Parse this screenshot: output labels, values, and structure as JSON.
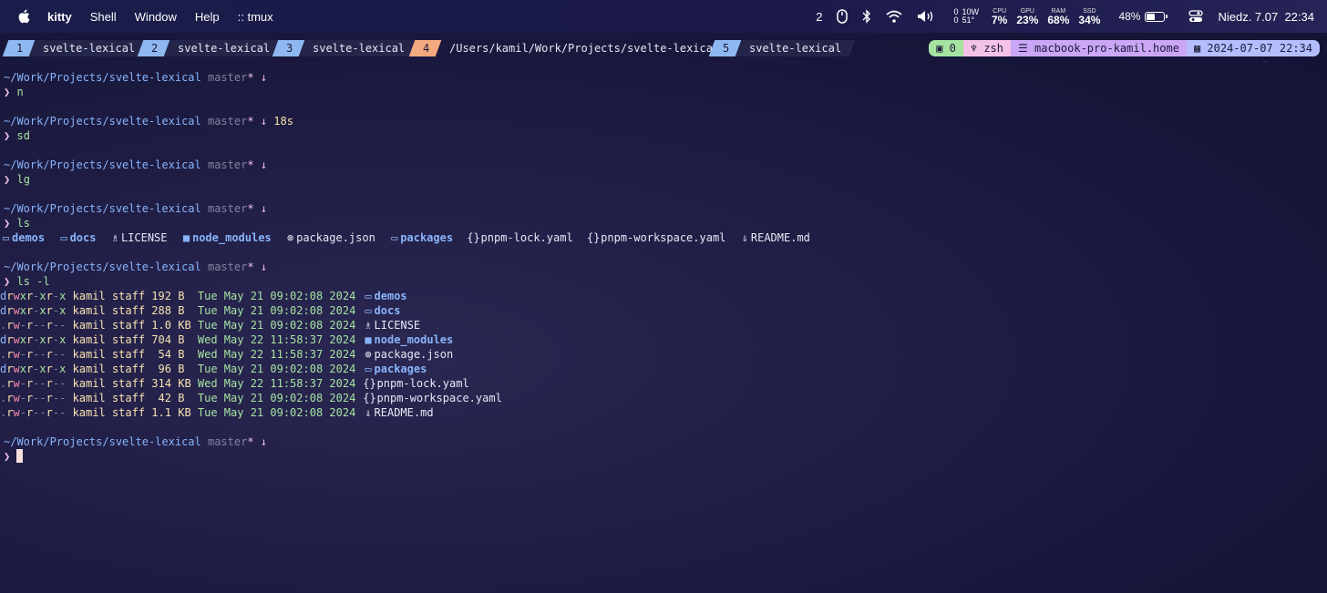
{
  "menubar": {
    "app_name": "kitty",
    "menus": [
      "Shell",
      "Window",
      "Help",
      ":: tmux"
    ],
    "spaces": "2",
    "power": {
      "watts": "10W",
      "temp": "51°",
      "a": "0",
      "b": "0"
    },
    "stats": [
      {
        "label": "CPU",
        "value": "7%"
      },
      {
        "label": "GPU",
        "value": "23%"
      },
      {
        "label": "RAM",
        "value": "68%"
      },
      {
        "label": "SSD",
        "value": "34%"
      }
    ],
    "battery": "48%",
    "battery_level": 0.48,
    "datetime": "Niedz. 7.07  22:34"
  },
  "tmux": {
    "windows": [
      {
        "num": "1",
        "name": "svelte-lexical",
        "active": false
      },
      {
        "num": "2",
        "name": "svelte-lexical",
        "active": false
      },
      {
        "num": "3",
        "name": "svelte-lexical",
        "active": false
      },
      {
        "num": "4",
        "name": "/Users/kamil/Work/Projects/svelte-lexical",
        "active": true
      },
      {
        "num": "5",
        "name": "svelte-lexical",
        "active": false
      }
    ],
    "status": {
      "session": "0",
      "shell": "zsh",
      "host": "macbook-pro-kamil.home",
      "date": "2024-07-07 22:34"
    }
  },
  "terminal": {
    "path": "~/Work/Projects/svelte-lexical",
    "branch": "master",
    "dirty": "*",
    "behind": "↓",
    "prompt_char": "❯",
    "blocks": [
      {
        "cmd": "n",
        "duration": ""
      },
      {
        "cmd": "sd",
        "duration": "18s"
      },
      {
        "cmd": "lg",
        "duration": ""
      },
      {
        "cmd": "ls",
        "duration": ""
      },
      {
        "cmd": "ls -l",
        "duration": ""
      }
    ],
    "ls_items": [
      {
        "name": "demos",
        "type": "dir"
      },
      {
        "name": "docs",
        "type": "dir"
      },
      {
        "name": "LICENSE",
        "type": "license"
      },
      {
        "name": "node_modules",
        "type": "dir-fill"
      },
      {
        "name": "package.json",
        "type": "npm"
      },
      {
        "name": "packages",
        "type": "dir"
      },
      {
        "name": "pnpm-lock.yaml",
        "type": "yaml"
      },
      {
        "name": "pnpm-workspace.yaml",
        "type": "yaml"
      },
      {
        "name": "README.md",
        "type": "md"
      }
    ],
    "ls_long": [
      {
        "perm": "drwxr-xr-x",
        "user": "kamil",
        "group": "staff",
        "size": "192",
        "unit": "B",
        "date": "Tue May 21 09:02:08 2024",
        "name": "demos",
        "type": "dir"
      },
      {
        "perm": "drwxr-xr-x",
        "user": "kamil",
        "group": "staff",
        "size": "288",
        "unit": "B",
        "date": "Tue May 21 09:02:08 2024",
        "name": "docs",
        "type": "dir"
      },
      {
        "perm": ".rw-r--r--",
        "user": "kamil",
        "group": "staff",
        "size": "1.0",
        "unit": "KB",
        "date": "Tue May 21 09:02:08 2024",
        "name": "LICENSE",
        "type": "license"
      },
      {
        "perm": "drwxr-xr-x",
        "user": "kamil",
        "group": "staff",
        "size": "704",
        "unit": "B",
        "date": "Wed May 22 11:58:37 2024",
        "name": "node_modules",
        "type": "dir-fill"
      },
      {
        "perm": ".rw-r--r--",
        "user": "kamil",
        "group": "staff",
        "size": "54",
        "unit": "B",
        "date": "Wed May 22 11:58:37 2024",
        "name": "package.json",
        "type": "npm"
      },
      {
        "perm": "drwxr-xr-x",
        "user": "kamil",
        "group": "staff",
        "size": "96",
        "unit": "B",
        "date": "Tue May 21 09:02:08 2024",
        "name": "packages",
        "type": "dir"
      },
      {
        "perm": ".rw-r--r--",
        "user": "kamil",
        "group": "staff",
        "size": "314",
        "unit": "KB",
        "date": "Wed May 22 11:58:37 2024",
        "name": "pnpm-lock.yaml",
        "type": "yaml"
      },
      {
        "perm": ".rw-r--r--",
        "user": "kamil",
        "group": "staff",
        "size": "42",
        "unit": "B",
        "date": "Tue May 21 09:02:08 2024",
        "name": "pnpm-workspace.yaml",
        "type": "yaml"
      },
      {
        "perm": ".rw-r--r--",
        "user": "kamil",
        "group": "staff",
        "size": "1.1",
        "unit": "KB",
        "date": "Tue May 21 09:02:08 2024",
        "name": "README.md",
        "type": "md"
      }
    ]
  },
  "colors": {
    "prompt": "#f5c2e7",
    "path": "#89b4fa",
    "command": "#a6e3a1",
    "active_window": "#f5a97f",
    "inactive_window": "#8fb8f0"
  }
}
